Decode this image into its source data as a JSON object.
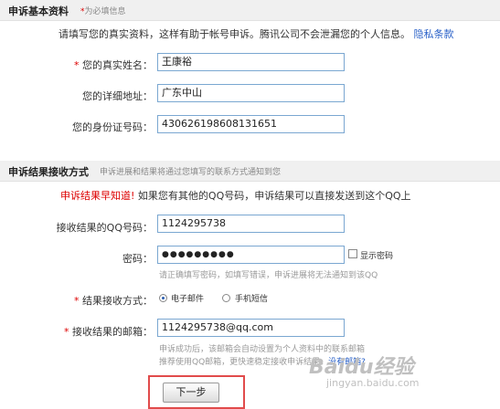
{
  "section1": {
    "title": "申诉基本资料",
    "required_star": "*",
    "required_note": "为必填信息"
  },
  "intro": {
    "text": "请填写您的真实资料，这样有助于帐号申诉。腾讯公司不会泄漏您的个人信息。",
    "privacy_link": "隐私条款"
  },
  "fields": {
    "name": {
      "star": "*",
      "label": "您的真实姓名：",
      "value": "王康裕"
    },
    "address": {
      "label": "您的详细地址：",
      "value": "广东中山"
    },
    "id_number": {
      "label": "您的身份证号码：",
      "value": "430626198608131651"
    }
  },
  "section2": {
    "title": "申诉结果接收方式",
    "note": "申诉进展和结果将通过您填写的联系方式通知到您"
  },
  "notice": {
    "red": "申诉结果早知道!",
    "text": "如果您有其他的QQ号码，申诉结果可以直接发送到这个QQ上"
  },
  "receive": {
    "qq": {
      "label": "接收结果的QQ号码：",
      "value": "1124295738"
    },
    "password": {
      "label": "密码：",
      "value": "●●●●●●●●●",
      "show_label": "显示密码",
      "show_checked": false,
      "hint": "请正确填写密码，如填写错误，申诉进展将无法通知到该QQ"
    },
    "method": {
      "star": "*",
      "label": "结果接收方式：",
      "options": [
        {
          "label": "电子邮件",
          "selected": true
        },
        {
          "label": "手机短信",
          "selected": false
        }
      ]
    },
    "email": {
      "star": "*",
      "label": "接收结果的邮箱：",
      "value": "1124295738@qq.com",
      "hint_line1": "申诉成功后，该邮箱会自动设置为个人资料中的联系邮箱",
      "hint_line2": "推荐使用QQ邮箱，更快速稳定接收申诉结果。",
      "hint_link": "没有邮箱?"
    }
  },
  "next_button": "下一步",
  "watermark": {
    "brand": "Baidu经验",
    "url": "jingyan.baidu.com"
  },
  "colors": {
    "accent_link": "#2a61c8",
    "required": "#dd0000",
    "input_border": "#7aa7d1",
    "highlight_frame": "#e14b4b"
  }
}
